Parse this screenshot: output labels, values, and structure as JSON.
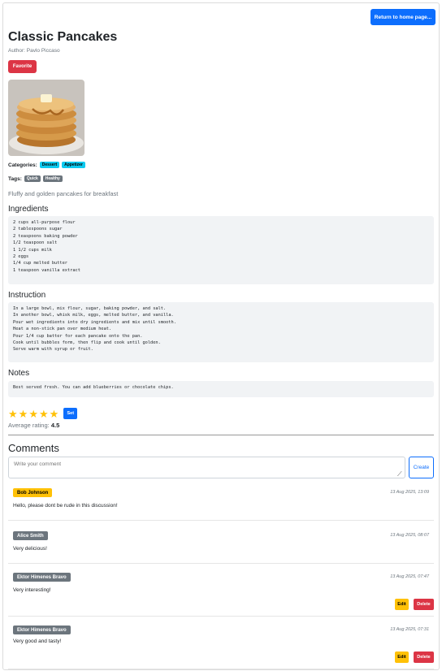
{
  "header": {
    "home_button": "Return to home page..."
  },
  "recipe": {
    "title": "Classic Pancakes",
    "author": "Author: Pavlo Piccaso",
    "favorite_button": "Favorite",
    "categories_label": "Categories:",
    "categories": [
      "Dessert",
      "Appetizer"
    ],
    "tags_label": "Tags:",
    "tags": [
      "Quick",
      "Healthy"
    ],
    "description": "Fluffy and golden pancakes for breakfast",
    "ingredients_heading": "Ingredients",
    "ingredients": "2 cups all-purpose flour\n2 tablespoons sugar\n2 teaspoons baking powder\n1/2 teaspoon salt\n1 1/2 cups milk\n2 eggs\n1/4 cup melted butter\n1 teaspoon vanilla extract",
    "instruction_heading": "Instruction",
    "instruction": "In a large bowl, mix flour, sugar, baking powder, and salt.\nIn another bowl, whisk milk, eggs, melted butter, and vanilla.\nPour wet ingredients into dry ingredients and mix until smooth.\nHeat a non-stick pan over medium heat.\nPour 1/4 cup batter for each pancake onto the pan.\nCook until bubbles form, then flip and cook until golden.\nServe warm with syrup or fruit.",
    "notes_heading": "Notes",
    "notes": "Best served fresh. You can add blueberries or chocolate chips."
  },
  "rating": {
    "stars": [
      "★",
      "★",
      "★",
      "★",
      "★"
    ],
    "set_button": "Set",
    "average_label": "Average rating:",
    "average_value": "4.5"
  },
  "comments": {
    "heading": "Comments",
    "placeholder": "Write your comment",
    "create_button": "Create",
    "edit_label": "Edit",
    "delete_label": "Delete",
    "items": [
      {
        "author": "Bob Johnson",
        "date": "13 Aug 2025, 13:09",
        "text": "Hello, please dont be rude in this discussion!"
      },
      {
        "author": "Alice Smith",
        "date": "13 Aug 2025, 08:07",
        "text": "Very delicious!"
      },
      {
        "author": "Ektor Himenes Bravo",
        "date": "13 Aug 2025, 07:47",
        "text": "Very interesting!"
      },
      {
        "author": "Ektor Himenes Bravo",
        "date": "13 Aug 2025, 07:31",
        "text": "Very good and tasty!"
      }
    ]
  },
  "colors": {
    "primary": "#0d6efd",
    "danger": "#dc3545",
    "warning": "#ffc107",
    "info": "#0dcaf0",
    "secondary": "#6c757d"
  }
}
